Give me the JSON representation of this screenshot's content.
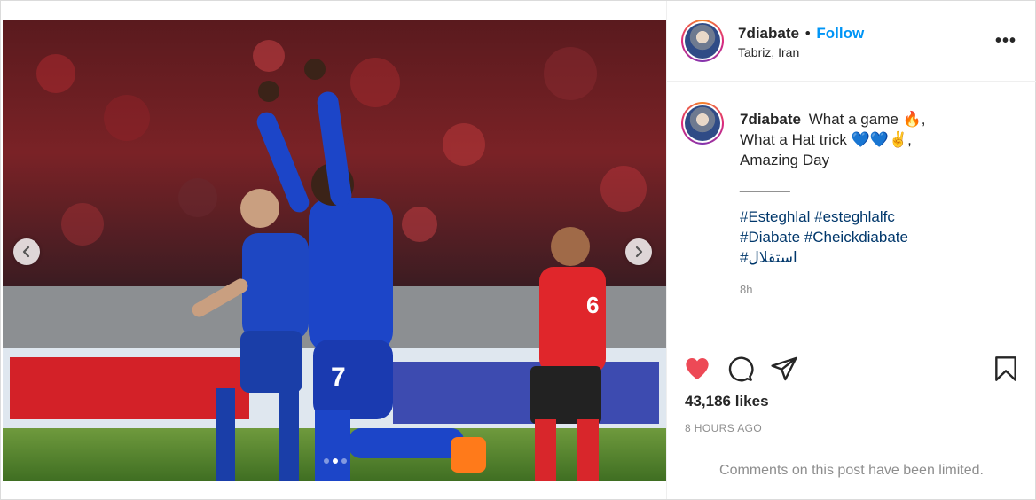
{
  "post": {
    "username": "7diabate",
    "follow_label": "Follow",
    "separator": "•",
    "location": "Tabriz, Iran",
    "more_label": "•••",
    "caption": {
      "line1": "What a game 🔥,",
      "line2": "What a Hat trick 💙💙✌️,",
      "line3": "Amazing Day",
      "divider": "______",
      "hashtags_line1": "#Esteghlal #esteghlalfc",
      "hashtags_line2": "#Diabate #Cheickdiabate",
      "hashtags_line3": "#استقلال",
      "time": "8h"
    },
    "likes": "43,186 likes",
    "posted_ago": "8 HOURS AGO",
    "comments_notice": "Comments on this post have been limited.",
    "carousel": {
      "total_slides": 3,
      "active_slide": 2
    },
    "colors": {
      "follow": "#0095f6",
      "like_active": "#ed4956",
      "hashtag": "#00376b",
      "muted": "#8e8e8e"
    },
    "icons": [
      "chevron-left-icon",
      "chevron-right-icon",
      "heart-icon",
      "comment-icon",
      "share-icon",
      "bookmark-icon"
    ]
  }
}
